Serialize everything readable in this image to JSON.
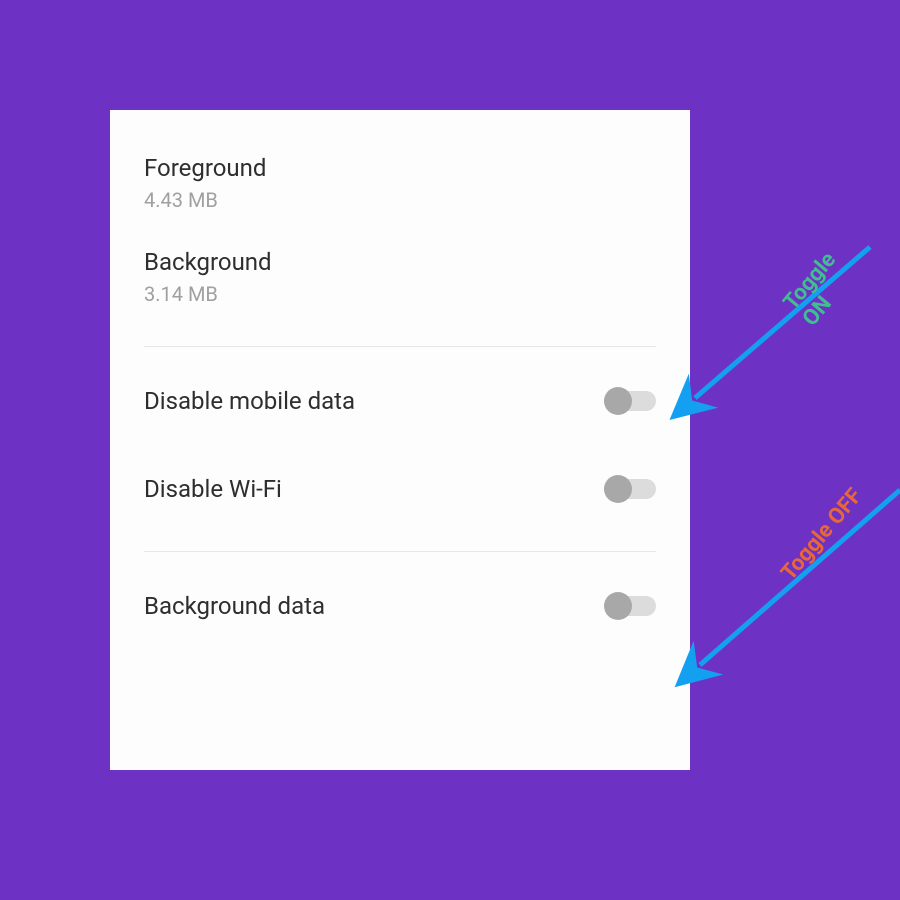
{
  "usage": {
    "foreground": {
      "label": "Foreground",
      "value": "4.43 MB"
    },
    "background": {
      "label": "Background",
      "value": "3.14 MB"
    }
  },
  "toggles": {
    "mobile_data": {
      "label": "Disable mobile data"
    },
    "wifi": {
      "label": "Disable Wi-Fi"
    },
    "bg_data": {
      "label": "Background data"
    }
  },
  "annotations": {
    "on_label": "Toggle ON",
    "off_label": "Toggle OFF"
  },
  "colors": {
    "background": "#6d32c4",
    "arrow": "#14a0f0",
    "anno_on": "#3fbf8f",
    "anno_off": "#e8673a"
  }
}
